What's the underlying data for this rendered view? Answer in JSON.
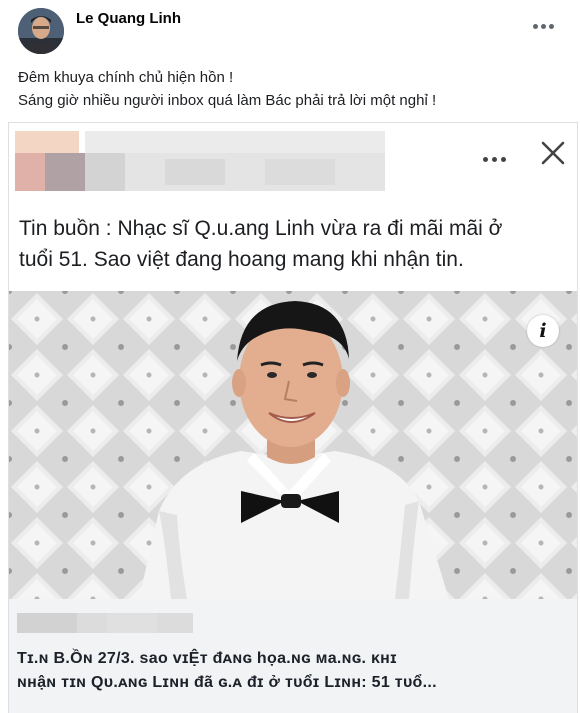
{
  "post": {
    "author": "Le Quang Linh",
    "more_icon": "more-horizontal-icon",
    "caption_lines": [
      "Đêm khuya chính chủ hiện hồn !",
      "Sáng giờ nhiều người inbox quá làm Bác phải trả lời một nghỉ !"
    ]
  },
  "shared": {
    "more_icon": "more-horizontal-icon",
    "close_icon": "close-icon",
    "headline_lines": [
      "Tin buồn : Nhạc sĩ Q.u.ang Linh vừa ra đi mãi mãi ở",
      "tuổi 51. Sao việt đang hoang mang khi nhận tin."
    ],
    "info_label": "i",
    "link_title_lines": [
      "Tɪ.ɴ B.Ồɴ 27/3. sao ᴠɪỆᴛ đᴀɴɢ họa.ɴɢ ᴍa.ɴɢ. ᴋʜɪ",
      "ɴʜậɴ ᴛɪɴ Qᴜ.ᴀɴɢ Lɪɴʜ đã ɢ.ᴀ đɪ ở ᴛᴜổɪ Lɪɴʜ: 51 ᴛᴜổ..."
    ]
  },
  "colors": {
    "link_bg": "#f2f3f5",
    "border": "#dddfe2",
    "text": "#1c1e21"
  }
}
